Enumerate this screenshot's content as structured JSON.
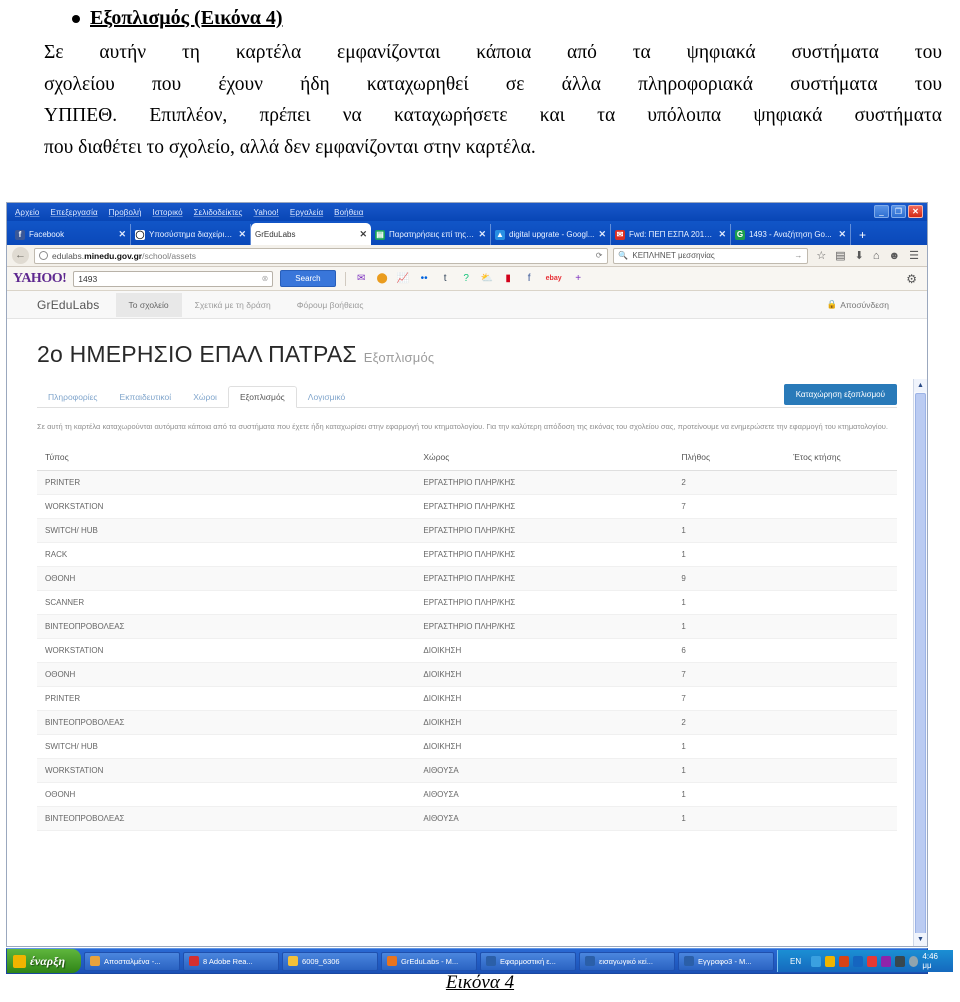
{
  "document": {
    "heading": "Εξοπλισμός (Εικόνα 4)",
    "paragraph_line1": "Σε αυτήν τη καρτέλα εμφανίζονται κάποια από τα ψηφιακά συστήματα του",
    "paragraph_line2": "σχολείου που έχουν ήδη καταχωρηθεί σε άλλα πληροφοριακά συστήματα του",
    "paragraph_line3": "ΥΠΠΕΘ. Επιπλέον, πρέπει να καταχωρήσετε και τα υπόλοιπα ψηφιακά συστήματα",
    "paragraph_line4": "που διαθέτει το σχολείο, αλλά δεν εμφανίζονται στην καρτέλα.",
    "caption": "Εικόνα 4"
  },
  "browser": {
    "menu": [
      "Αρχείο",
      "Επεξεργασία",
      "Προβολή",
      "Ιστορικό",
      "Σελιδοδείκτες",
      "Yahoo!",
      "Εργαλεία",
      "Βοήθεια"
    ],
    "window_buttons": {
      "minimize": "_",
      "restore": "❐",
      "close": "✕"
    },
    "tabs": [
      {
        "label": "Facebook",
        "favicon": "f",
        "favicon_color": "#3b5998",
        "active": false,
        "close": "✕"
      },
      {
        "label": "Υποσύστημα διαχείρισ...",
        "favicon": "◯",
        "favicon_color": "#ffffff",
        "active": false,
        "close": "✕"
      },
      {
        "label": "GrEduLabs",
        "favicon": "",
        "favicon_color": "transparent",
        "active": true,
        "close": "✕"
      },
      {
        "label": "Παρατηρήσεις επί της ...",
        "favicon": "▤",
        "favicon_color": "#1ba05c",
        "active": false,
        "close": "✕"
      },
      {
        "label": "digital upgrate - Googl...",
        "favicon": "▲",
        "favicon_color": "#2a8fe0",
        "active": false,
        "close": "✕"
      },
      {
        "label": "Fwd: ΠΕΠ ΕΣΠΑ 2014...",
        "favicon": "✉",
        "favicon_color": "#d93025",
        "active": false,
        "close": "✕"
      },
      {
        "label": "1493 - Αναζήτηση Go...",
        "favicon": "G",
        "favicon_color": "#1e9e50",
        "active": false,
        "close": "✕"
      }
    ],
    "new_tab_label": "+",
    "url_domain": "edulabs.minedu.gov.gr",
    "url_prefix": "edulabs.",
    "url_path": "/school/assets",
    "url_reload": "⟳",
    "nav_search_value": "ΚΕΠΛΗΝΕΤ μεσσηνίας",
    "nav_icons": [
      "star-icon",
      "reader-icon",
      "download-icon",
      "home-icon",
      "chat-icon",
      "menu-icon"
    ],
    "yahoo": {
      "logo": "YAHOO!",
      "search_value": "1493",
      "search_button": "Search",
      "icons": [
        {
          "name": "yahoo-mail-icon",
          "glyph": "✉",
          "color": "#7b2fbd"
        },
        {
          "name": "yahoo-sports-icon",
          "glyph": "⬤",
          "color": "#e89b20"
        },
        {
          "name": "yahoo-finance-icon",
          "glyph": "📈",
          "color": "#4fc3e8"
        },
        {
          "name": "flickr-icon",
          "glyph": "••",
          "color": "#0063dc"
        },
        {
          "name": "tumblr-icon",
          "glyph": "t",
          "color": "#35465c"
        },
        {
          "name": "yahoo-answers-icon",
          "glyph": "?",
          "color": "#17c37b"
        },
        {
          "name": "weather-icon",
          "glyph": "⛅",
          "color": "#6aa9e0"
        },
        {
          "name": "bookmark-icon",
          "glyph": "▮",
          "color": "#d0021b"
        },
        {
          "name": "facebook-icon",
          "glyph": "f",
          "color": "#3b5998"
        },
        {
          "name": "ebay-icon",
          "glyph": "ebay",
          "color": "#e53238"
        },
        {
          "name": "add-icon",
          "glyph": "+",
          "color": "#7b2fbd"
        }
      ],
      "gear": "⚙"
    }
  },
  "app": {
    "brand": "GrEduLabs",
    "nav": [
      {
        "label": "Το σχολείο",
        "active": true
      },
      {
        "label": "Σχετικά με τη δράση",
        "active": false
      },
      {
        "label": "Φόρουμ βοήθειας",
        "active": false
      }
    ],
    "logout": "Αποσύνδεση",
    "logout_icon": "🔒",
    "school_name": "2ο ΗΜΕΡΗΣΙΟ ΕΠΑΛ ΠΑΤΡΑΣ",
    "section": "Εξοπλισμός",
    "tabs": [
      {
        "label": "Πληροφορίες",
        "active": false
      },
      {
        "label": "Εκπαιδευτικοί",
        "active": false
      },
      {
        "label": "Χώροι",
        "active": false
      },
      {
        "label": "Εξοπλισμός",
        "active": true
      },
      {
        "label": "Λογισμικό",
        "active": false
      }
    ],
    "add_button": "Καταχώρηση εξοπλισμού",
    "notice": "Σε αυτή τη καρτέλα καταχωρούνται αυτόματα κάποια από τα συστήματα που έχετε ήδη καταχωρίσει στην εφαρμογή του κτηματολογίου. Για την καλύτερη απόδοση της εικόνας του σχολείου σας, προτείνουμε να ενημερώσετε την εφαρμογή του κτηματολογίου.",
    "table": {
      "headers": [
        "Τύπος",
        "Χώρος",
        "Πλήθος",
        "Έτος κτήσης"
      ],
      "rows": [
        {
          "type": "PRINTER",
          "room": "ΕΡΓΑΣΤΗΡΙΟ ΠΛΗΡ/ΚΗΣ",
          "count": "2",
          "year": ""
        },
        {
          "type": "WORKSTATION",
          "room": "ΕΡΓΑΣΤΗΡΙΟ ΠΛΗΡ/ΚΗΣ",
          "count": "7",
          "year": ""
        },
        {
          "type": "SWITCH/ HUB",
          "room": "ΕΡΓΑΣΤΗΡΙΟ ΠΛΗΡ/ΚΗΣ",
          "count": "1",
          "year": ""
        },
        {
          "type": "RACK",
          "room": "ΕΡΓΑΣΤΗΡΙΟ ΠΛΗΡ/ΚΗΣ",
          "count": "1",
          "year": ""
        },
        {
          "type": "ΟΘΟΝΗ",
          "room": "ΕΡΓΑΣΤΗΡΙΟ ΠΛΗΡ/ΚΗΣ",
          "count": "9",
          "year": ""
        },
        {
          "type": "SCANNER",
          "room": "ΕΡΓΑΣΤΗΡΙΟ ΠΛΗΡ/ΚΗΣ",
          "count": "1",
          "year": ""
        },
        {
          "type": "ΒΙΝΤΕΟΠΡΟΒΟΛΕΑΣ",
          "room": "ΕΡΓΑΣΤΗΡΙΟ ΠΛΗΡ/ΚΗΣ",
          "count": "1",
          "year": ""
        },
        {
          "type": "WORKSTATION",
          "room": "ΔΙΟΙΚΗΣΗ",
          "count": "6",
          "year": ""
        },
        {
          "type": "ΟΘΟΝΗ",
          "room": "ΔΙΟΙΚΗΣΗ",
          "count": "7",
          "year": ""
        },
        {
          "type": "PRINTER",
          "room": "ΔΙΟΙΚΗΣΗ",
          "count": "7",
          "year": ""
        },
        {
          "type": "ΒΙΝΤΕΟΠΡΟΒΟΛΕΑΣ",
          "room": "ΔΙΟΙΚΗΣΗ",
          "count": "2",
          "year": ""
        },
        {
          "type": "SWITCH/ HUB",
          "room": "ΔΙΟΙΚΗΣΗ",
          "count": "1",
          "year": ""
        },
        {
          "type": "WORKSTATION",
          "room": "ΑΙΘΟΥΣΑ",
          "count": "1",
          "year": ""
        },
        {
          "type": "ΟΘΟΝΗ",
          "room": "ΑΙΘΟΥΣΑ",
          "count": "1",
          "year": ""
        },
        {
          "type": "ΒΙΝΤΕΟΠΡΟΒΟΛΕΑΣ",
          "room": "ΑΙΘΟΥΣΑ",
          "count": "1",
          "year": ""
        }
      ]
    }
  },
  "taskbar": {
    "start_label": "έναρξη",
    "items": [
      {
        "label": "Αποσταλμένα -...",
        "color": "#e8a33d"
      },
      {
        "label": "8 Adobe Rea...",
        "color": "#d32f2f"
      },
      {
        "label": "6009_6306",
        "color": "#f3c13a"
      },
      {
        "label": "GrEduLabs - M...",
        "color": "#e8741f"
      },
      {
        "label": "Εφαρμοστική ε...",
        "color": "#2b5fa8"
      },
      {
        "label": "εισαγωγικό κεί...",
        "color": "#2b5fa8"
      },
      {
        "label": "Εγγραφο3 - M...",
        "color": "#2b5fa8"
      }
    ],
    "language": "EN",
    "clock": "4:46 μμ",
    "tray_icons": [
      "network-icon",
      "messenger-icon",
      "download-icon",
      "sync-icon",
      "shield-icon",
      "users-icon",
      "app-icon",
      "volume-icon"
    ]
  }
}
